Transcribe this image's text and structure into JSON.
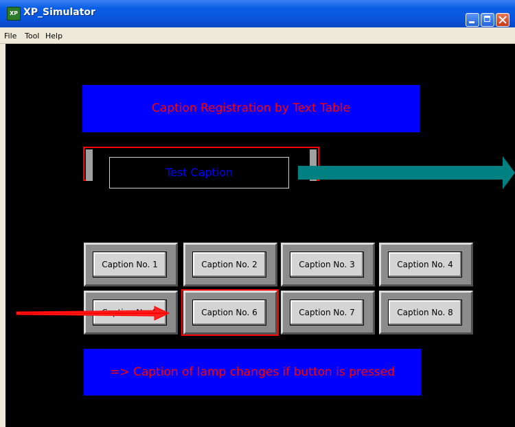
{
  "window": {
    "title": "XP_Simulator",
    "app_icon_text": "XP"
  },
  "menu": [
    {
      "label": "File"
    },
    {
      "label": "Tool"
    },
    {
      "label": "Help"
    }
  ],
  "panels": {
    "title": "Caption Registration by Text Table",
    "note": "=> Caption of lamp changes if button is pressed"
  },
  "lamp": {
    "caption": "Test Caption"
  },
  "buttons": [
    {
      "label": "Caption No. 1"
    },
    {
      "label": "Caption No. 2"
    },
    {
      "label": "Caption No. 3"
    },
    {
      "label": "Caption No. 4"
    },
    {
      "label": "Caption No. 5"
    },
    {
      "label": "Caption No. 6"
    },
    {
      "label": "Caption No. 7"
    },
    {
      "label": "Caption No. 8"
    }
  ],
  "colors": {
    "panel_background": "#0000fe",
    "panel_text": "#ff0000",
    "highlight": "#ff0000",
    "arrow_teal": "#008080",
    "content_background": "#000000"
  }
}
